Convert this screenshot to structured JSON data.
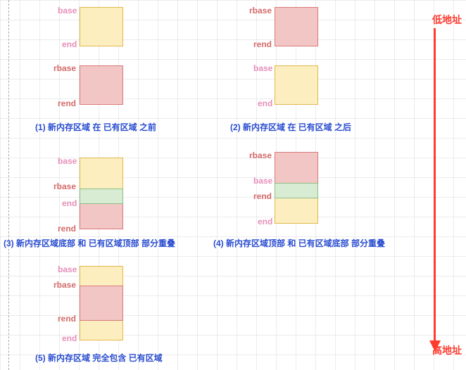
{
  "arrow": {
    "low": "低地址",
    "high": "高地址"
  },
  "labels": {
    "base": "base",
    "end": "end",
    "rbase": "rbase",
    "rend": "rend"
  },
  "captions": {
    "c1": "(1) 新内存区域 在 已有区域 之前",
    "c2": "(2) 新内存区域 在 已有区域 之后",
    "c3": "(3) 新内存区域底部 和 已有区域顶部 部分重叠",
    "c4": "(4) 新内存区域顶部 和 已有区域底部 部分重叠",
    "c5": "(5) 新内存区域 完全包含 已有区域"
  }
}
